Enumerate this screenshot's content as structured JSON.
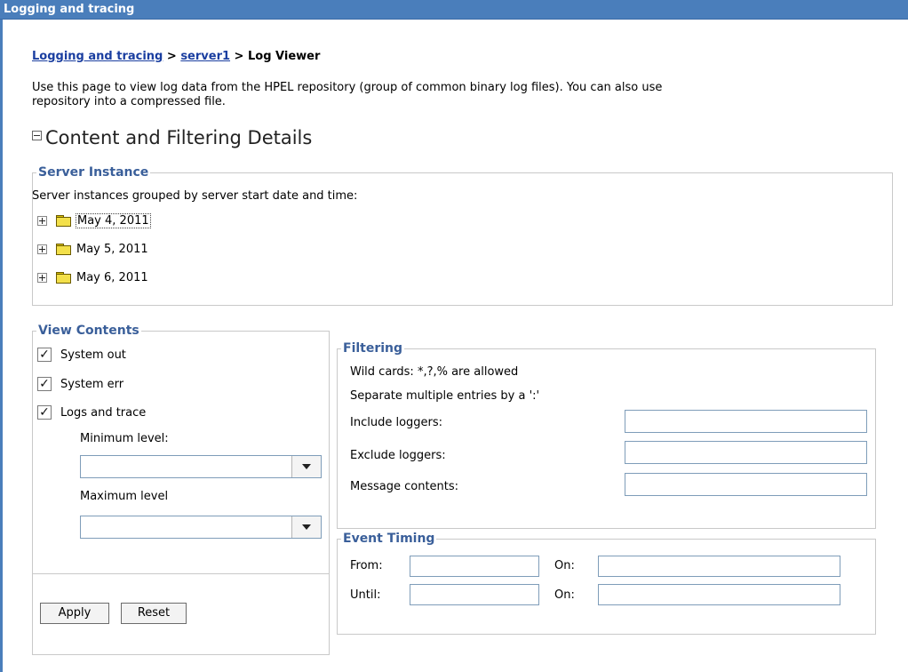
{
  "window": {
    "title": "Logging and tracing"
  },
  "breadcrumb": {
    "link1": "Logging and tracing",
    "sep1": " > ",
    "link2": "server1",
    "sep2": " > ",
    "current": "Log Viewer"
  },
  "description": {
    "line1": "Use this page to view log data from the HPEL repository (group of common binary log files). You can also use",
    "line2": "repository into a compressed file."
  },
  "section": {
    "title": "Content and Filtering Details"
  },
  "server_instance": {
    "legend": "Server Instance",
    "caption": "Server instances grouped by server start date and time:",
    "items": [
      {
        "label": "May 4, 2011"
      },
      {
        "label": "May 5, 2011"
      },
      {
        "label": "May 6, 2011"
      }
    ]
  },
  "view_contents": {
    "legend": "View Contents",
    "checks": [
      {
        "label": "System out",
        "mark": "✓"
      },
      {
        "label": "System err",
        "mark": "✓"
      },
      {
        "label": "Logs and trace",
        "mark": "✓"
      }
    ],
    "min_label": "Minimum level:",
    "max_label": "Maximum level"
  },
  "filtering": {
    "legend": "Filtering",
    "wildcards": "Wild cards: *,?,% are allowed",
    "separate": "Separate multiple entries by a ':'",
    "include_label": "Include loggers:",
    "exclude_label": "Exclude loggers:",
    "message_label": "Message contents:"
  },
  "event_timing": {
    "legend": "Event Timing",
    "from_label": "From:",
    "until_label": "Until:",
    "on_label": "On:"
  },
  "buttons": {
    "apply": "Apply",
    "reset": "Reset"
  }
}
